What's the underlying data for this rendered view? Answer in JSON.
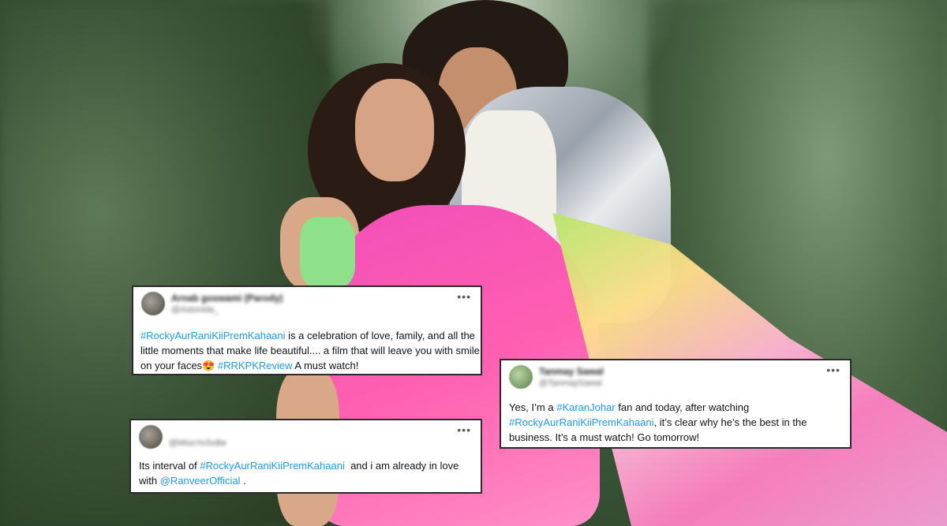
{
  "colors": {
    "link": "#1d9bf0",
    "card_border": "#2b2b2b"
  },
  "background": {
    "description_icon": "photo-backdrop"
  },
  "tweets": [
    {
      "name": "Arnab goswami (Parody)",
      "handle": "@Astonida_",
      "more_icon": "more-icon",
      "segments": [
        "#RockyAurRaniKiiPremKahaani",
        " is a celebration of love, family, and all the little moments that make life beautiful.... a film that will leave you with smile on your faces",
        "😍",
        " ",
        "#RRKPKReview",
        " A must watch!"
      ]
    },
    {
      "name": "",
      "handle": "@MissYoSoBe",
      "more_icon": "more-icon",
      "segments": [
        "Its interval of ",
        "#RockyAurRaniKiiPremKahaani",
        "  and i am already in love with ",
        "@RanveerOfficial",
        " ."
      ]
    },
    {
      "name": "Tanmay Sawal",
      "handle": "@TanmaySawal",
      "more_icon": "more-icon",
      "segments": [
        "Yes, I’m a ",
        "#KaranJohar",
        " fan and today, after watching ",
        "#RockyAurRaniKiiPremKahaani",
        ", it’s clear why he’s the best in the business. It’s a must watch! Go tomorrow!"
      ]
    }
  ]
}
